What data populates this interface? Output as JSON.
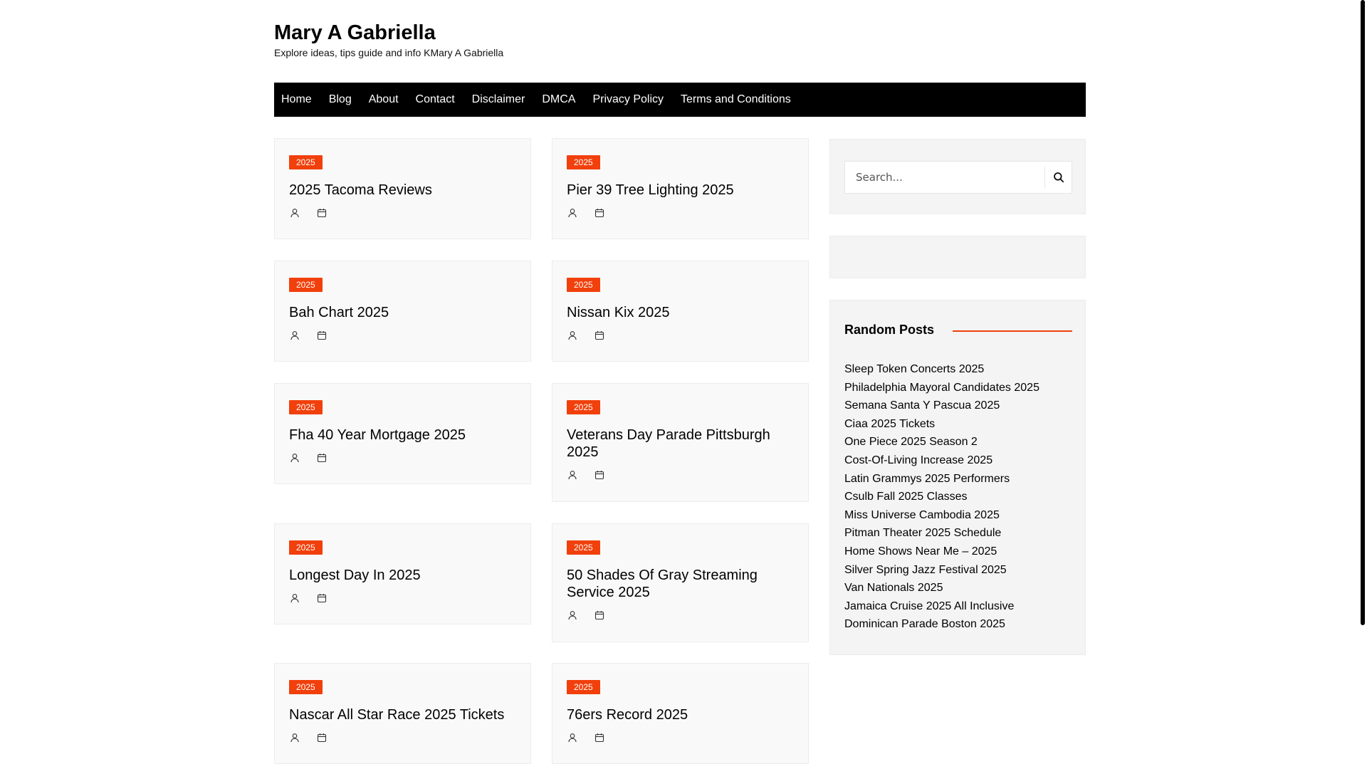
{
  "site": {
    "title": "Mary A Gabriella",
    "description": "Explore ideas, tips guide and info KMary A Gabriella"
  },
  "nav": [
    "Home",
    "Blog",
    "About",
    "Contact",
    "Disclaimer",
    "DMCA",
    "Privacy Policy",
    "Terms and Conditions"
  ],
  "posts": [
    {
      "category": "2025",
      "title": "2025 Tacoma Reviews"
    },
    {
      "category": "2025",
      "title": "Pier 39 Tree Lighting 2025"
    },
    {
      "category": "2025",
      "title": "Bah Chart 2025"
    },
    {
      "category": "2025",
      "title": "Nissan Kix 2025"
    },
    {
      "category": "2025",
      "title": "Fha 40 Year Mortgage 2025"
    },
    {
      "category": "2025",
      "title": "Veterans Day Parade Pittsburgh 2025"
    },
    {
      "category": "2025",
      "title": "Longest Day In 2025"
    },
    {
      "category": "2025",
      "title": "50 Shades Of Gray Streaming Service 2025"
    },
    {
      "category": "2025",
      "title": "Nascar All Star Race 2025 Tickets"
    },
    {
      "category": "2025",
      "title": "76ers Record 2025"
    }
  ],
  "post_meta_icons": [
    "user-icon",
    "calendar-icon"
  ],
  "search": {
    "placeholder": "Search...",
    "icon": "search-icon"
  },
  "random_posts": {
    "title": "Random Posts",
    "items": [
      "Sleep Token Concerts 2025",
      "Philadelphia Mayoral Candidates 2025",
      "Semana Santa Y Pascua 2025",
      "Ciaa 2025 Tickets",
      "One Piece 2025 Season 2",
      "Cost-Of-Living Increase 2025",
      "Latin Grammys 2025 Performers",
      "Csulb Fall 2025 Classes",
      "Miss Universe Cambodia 2025",
      "Pitman Theater 2025 Schedule",
      "Home Shows Near Me – 2025",
      "Silver Spring Jazz Festival 2025",
      "Van Nationals 2025",
      "Jamaica Cruise 2025 All Inclusive",
      "Dominican Parade Boston 2025"
    ]
  },
  "colors": {
    "accent": "#f1400c",
    "nav_bg": "#000000",
    "card_bg": "#f9f9f9"
  }
}
